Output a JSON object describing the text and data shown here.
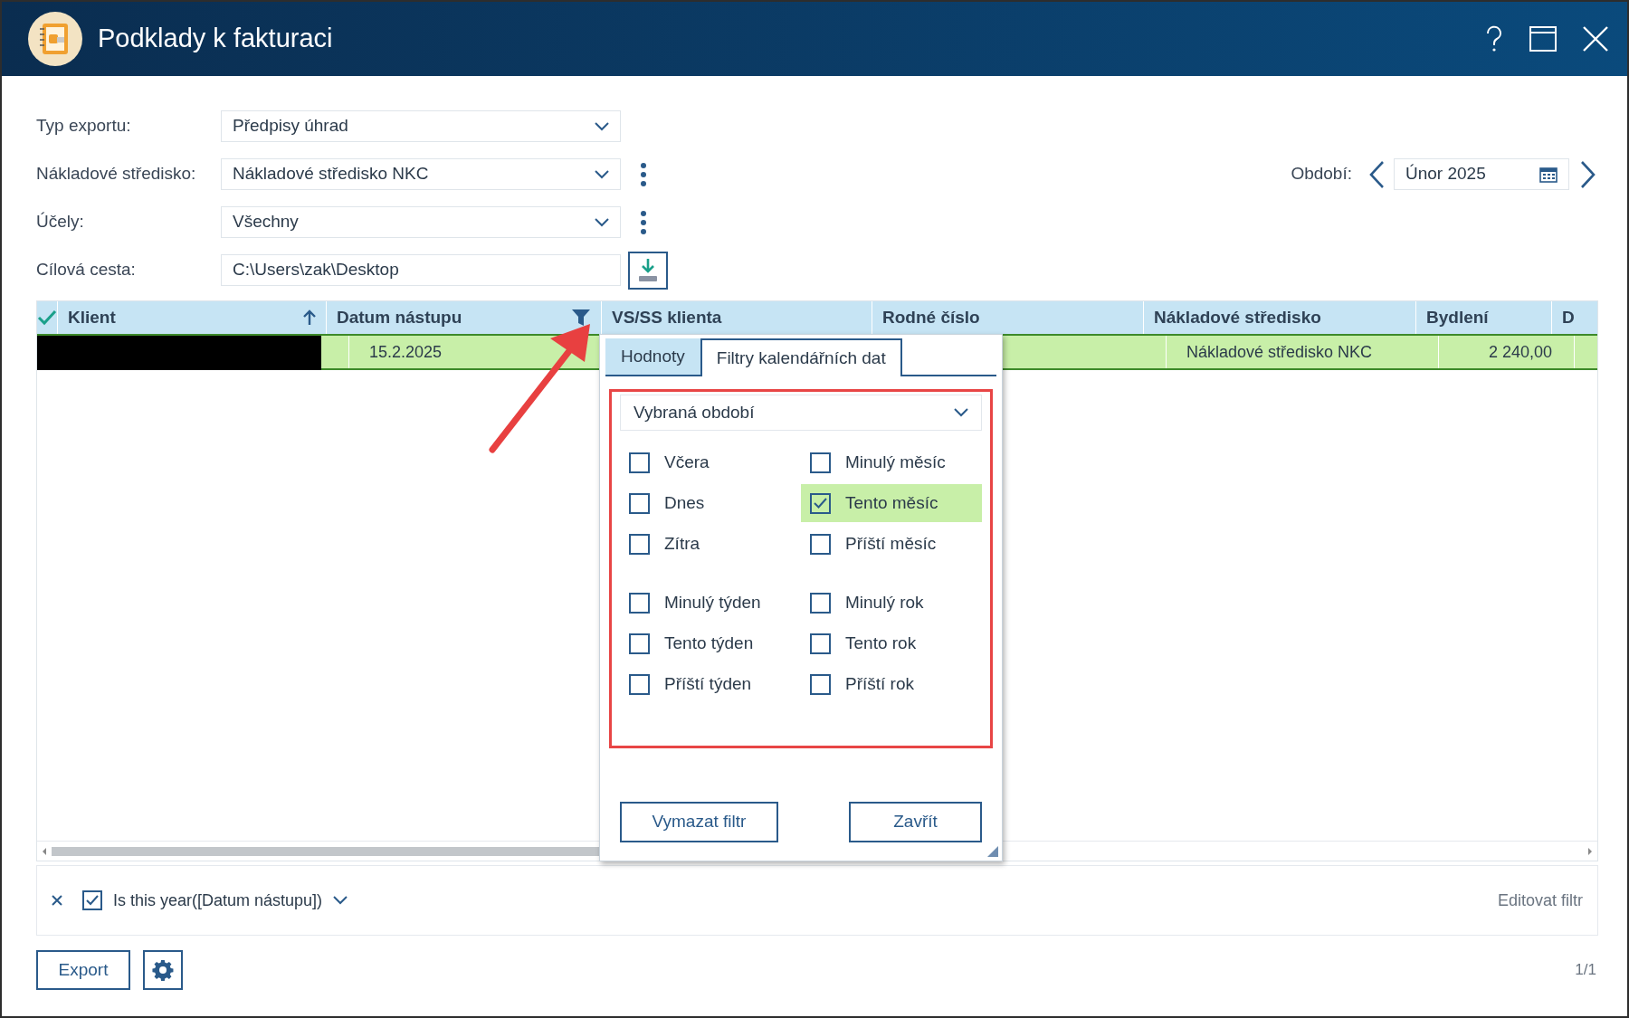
{
  "window": {
    "title": "Podklady k fakturaci"
  },
  "form": [
    {
      "label": "Typ exportu:",
      "value": "Předpisy úhrad",
      "kind": "select",
      "has_menu": false
    },
    {
      "label": "Nákladové středisko:",
      "value": "Nákladové středisko NKC",
      "kind": "select",
      "has_menu": true
    },
    {
      "label": "Účely:",
      "value": "Všechny",
      "kind": "select",
      "has_menu": true
    },
    {
      "label": "Cílová cesta:",
      "value": "C:\\Users\\zak\\Desktop",
      "kind": "path",
      "has_menu": false
    }
  ],
  "period": {
    "label": "Období:",
    "value": "Únor 2025"
  },
  "table": {
    "columns": [
      {
        "label": "Klient",
        "sorted": true,
        "filter": false
      },
      {
        "label": "Datum nástupu",
        "sorted": false,
        "filter": true
      },
      {
        "label": "VS/SS klienta",
        "sorted": false,
        "filter": false
      },
      {
        "label": "Rodné číslo",
        "sorted": false,
        "filter": false
      },
      {
        "label": "Nákladové středisko",
        "sorted": false,
        "filter": false
      },
      {
        "label": "Bydlení",
        "sorted": false,
        "filter": false
      },
      {
        "label": "D",
        "sorted": false,
        "filter": false
      }
    ],
    "rows": [
      {
        "selected": true,
        "client_redacted": true,
        "cells": [
          null,
          "15.2.2025",
          null,
          null,
          "Nákladové středisko NKC",
          "2 240,00",
          null
        ]
      }
    ]
  },
  "filter_popup": {
    "tabs": [
      {
        "label": "Hodnoty",
        "selected": false
      },
      {
        "label": "Filtry kalendářních dat",
        "selected": true
      }
    ],
    "mode": "Vybraná období",
    "groups": [
      [
        {
          "label": "Včera",
          "checked": false
        },
        {
          "label": "Minulý měsíc",
          "checked": false
        },
        {
          "label": "Dnes",
          "checked": false
        },
        {
          "label": "Tento měsíc",
          "checked": true
        },
        {
          "label": "Zítra",
          "checked": false
        },
        {
          "label": "Příští měsíc",
          "checked": false
        }
      ],
      [
        {
          "label": "Minulý týden",
          "checked": false
        },
        {
          "label": "Minulý rok",
          "checked": false
        },
        {
          "label": "Tento týden",
          "checked": false
        },
        {
          "label": "Tento rok",
          "checked": false
        },
        {
          "label": "Příští týden",
          "checked": false
        },
        {
          "label": "Příští rok",
          "checked": false
        }
      ]
    ],
    "buttons": [
      "Vymazat filtr",
      "Zavřít"
    ]
  },
  "filter_bar": {
    "checked": true,
    "expression": "Is this year([Datum nástupu])",
    "edit_link": "Editovat filtr"
  },
  "footer": {
    "buttons": [
      "Export"
    ],
    "page": "1/1"
  }
}
